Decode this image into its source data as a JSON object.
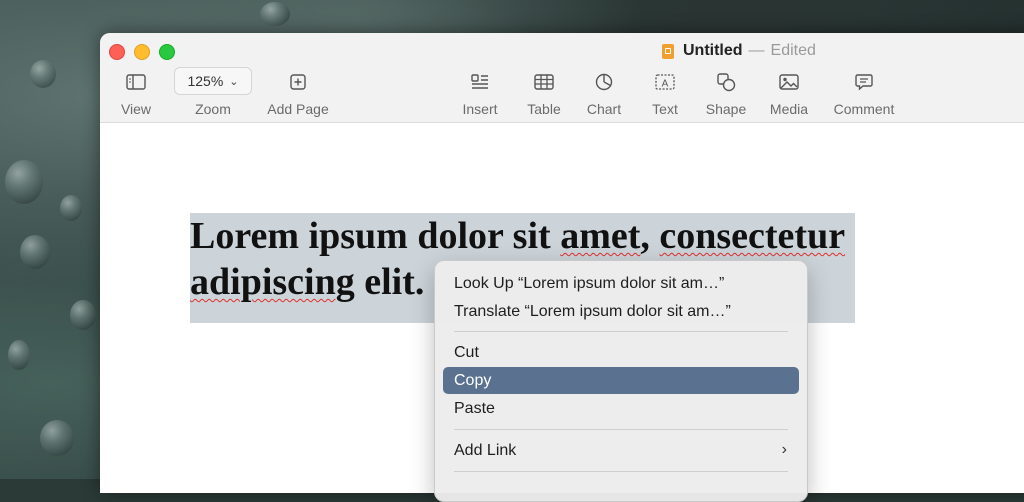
{
  "window": {
    "doc_title": "Untitled",
    "separator": "—",
    "status": "Edited"
  },
  "toolbar": {
    "view": {
      "label": "View",
      "icon": "sidebar-icon"
    },
    "zoom": {
      "label": "Zoom",
      "value": "125%",
      "icon": "chevron-down-icon"
    },
    "add_page": {
      "label": "Add Page",
      "icon": "plus-square-icon"
    },
    "insert": {
      "label": "Insert",
      "icon": "insert-paragraph-icon"
    },
    "table": {
      "label": "Table",
      "icon": "table-icon"
    },
    "chart": {
      "label": "Chart",
      "icon": "pie-chart-icon"
    },
    "text": {
      "label": "Text",
      "icon": "text-box-icon"
    },
    "shape": {
      "label": "Shape",
      "icon": "shape-icon"
    },
    "media": {
      "label": "Media",
      "icon": "image-icon"
    },
    "comment": {
      "label": "Comment",
      "icon": "comment-icon"
    }
  },
  "document": {
    "line1_a": "Lorem ipsum dolor sit ",
    "line1_b": "amet",
    "line1_c": ", ",
    "line1_d": "consectetur",
    "line2_a": "adipiscing",
    "line2_b": " elit."
  },
  "context_menu": {
    "look_up": "Look Up “Lorem ipsum dolor sit am…”",
    "translate": "Translate “Lorem ipsum dolor sit am…”",
    "cut": "Cut",
    "copy": "Copy",
    "paste": "Paste",
    "add_link": "Add Link",
    "highlight_color": "#5a7190"
  }
}
